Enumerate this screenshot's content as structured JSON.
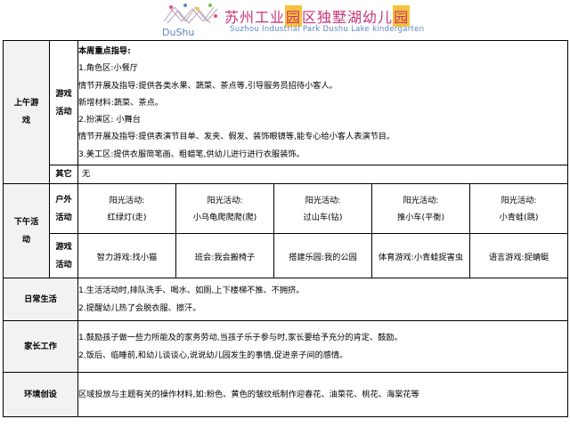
{
  "logo": {
    "brand_en_short": "DuShu",
    "title_cn_1": "苏州工业",
    "title_cn_box1": "园",
    "title_cn_2": "区",
    "title_cn_3": "独墅湖幼儿",
    "title_cn_box2": "园",
    "title_en": "Suzhou Industrial Park Dushu Lake kindergarten"
  },
  "morning": {
    "label": "上午游戏",
    "game_label": "游戏活动",
    "heading": "本周重点指导:",
    "lines": [
      "1.角色区:小餐厅",
      "情节开展及指导:提供各类水果、蔬菜、茶点等,引导服务员招待小客人。",
      "新增材料:蔬菜、茶点。",
      "2.扮演区: 小舞台",
      "情节开展及指导:提供表演节目单、发夹、假发、装饰眼镜等,能专心给小客人表演节目。",
      "3.美工区:提供衣服简笔画、粗蜡笔,供幼儿进行进行衣服装饰。"
    ],
    "other_label": "其它",
    "other_value": "无"
  },
  "afternoon": {
    "label": "下午活动",
    "outdoor_label": "户外活动",
    "game_label": "游戏活动",
    "outdoor": [
      {
        "title": "阳光活动:",
        "name": "红绿灯(走)"
      },
      {
        "title": "阳光活动:",
        "name": "小乌龟爬爬爬(爬)"
      },
      {
        "title": "阳光活动:",
        "name": "过山车(钻)"
      },
      {
        "title": "阳光活动:",
        "name": "推小车(平衡)"
      },
      {
        "title": "阳光活动:",
        "name": "小青蛙(跳)"
      }
    ],
    "games": [
      "智力游戏:找小猫",
      "班会:我会搬椅子",
      "搭建乐园:我的公园",
      "体育游戏:小青蛙捉害虫",
      "语言游戏:捉蜻蜓"
    ]
  },
  "daily": {
    "label": "日常生活",
    "lines": [
      "1.生活活动时,排队洗手、喝水、如厕,上下楼梯不推、不拥挤。",
      "2.提醒幼儿热了会脱衣服、擦汗。"
    ]
  },
  "parents": {
    "label": "家长工作",
    "lines": [
      "1.鼓励孩子做一些力所能及的家务劳动,当孩子乐于参与时,家长要给予充分的肯定、鼓励。",
      "2.饭后、临睡前,和幼儿谈谈心,说说幼儿园发生的事情,促进亲子间的感情。"
    ]
  },
  "environment": {
    "label": "环境创设",
    "text": "区域投放与主题有关的操作材料,如:粉色、黄色的皱纹纸制作迎春花、油菜花、桃花、海棠花等"
  },
  "colors": {
    "brand_pink": "#c83276",
    "brand_yellow": "#f6c23a",
    "brand_blue": "#5e86c4",
    "label_bg": "#f2f2f2"
  }
}
